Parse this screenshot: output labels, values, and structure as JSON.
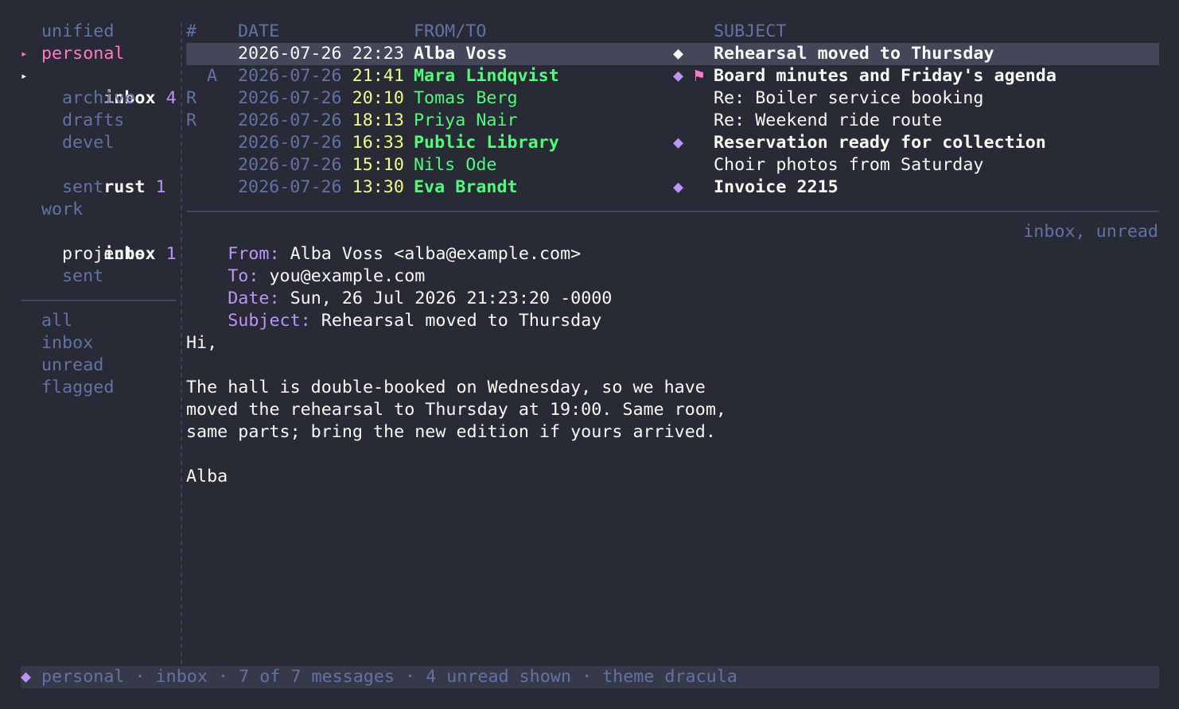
{
  "sidebar": {
    "accounts": [
      {
        "label": "unified"
      },
      {
        "label": "personal",
        "marker": "▸"
      },
      {
        "label": "inbox",
        "count": "4",
        "marker": "▸"
      },
      {
        "label": "archive"
      },
      {
        "label": "drafts"
      },
      {
        "label": "devel"
      },
      {
        "label": "rust",
        "count": "1"
      },
      {
        "label": "sent"
      },
      {
        "label": "work"
      },
      {
        "label": "inbox",
        "count": "1"
      },
      {
        "label": "projects"
      },
      {
        "label": "sent"
      }
    ],
    "views": [
      "all",
      "inbox",
      "unread",
      "flagged"
    ]
  },
  "list": {
    "headers": {
      "num": "#",
      "date": "DATE",
      "from": "FROM/TO",
      "subject": "SUBJECT"
    },
    "rows": [
      {
        "flag": "",
        "date": "2026-07-26",
        "time": "22:23",
        "from": "Alba Voss",
        "diamond": "◆",
        "star": "",
        "subject": "Rehearsal moved to Thursday",
        "unread": true,
        "selected": true
      },
      {
        "flag": "A",
        "date": "2026-07-26",
        "time": "21:41",
        "from": "Mara Lindqvist",
        "diamond": "◆",
        "star": "⚑",
        "subject": "Board minutes and Friday's agenda",
        "unread": true,
        "selected": false
      },
      {
        "flag": "R",
        "date": "2026-07-26",
        "time": "20:10",
        "from": "Tomas Berg",
        "diamond": "",
        "star": "",
        "subject": "Re: Boiler service booking",
        "unread": false,
        "selected": false
      },
      {
        "flag": "R",
        "date": "2026-07-26",
        "time": "18:13",
        "from": "Priya Nair",
        "diamond": "",
        "star": "",
        "subject": "Re: Weekend ride route",
        "unread": false,
        "selected": false
      },
      {
        "flag": "",
        "date": "2026-07-26",
        "time": "16:33",
        "from": "Public Library",
        "diamond": "◆",
        "star": "",
        "subject": "Reservation ready for collection",
        "unread": true,
        "selected": false
      },
      {
        "flag": "",
        "date": "2026-07-26",
        "time": "15:10",
        "from": "Nils Ode",
        "diamond": "",
        "star": "",
        "subject": "Choir photos from Saturday",
        "unread": false,
        "selected": false
      },
      {
        "flag": "",
        "date": "2026-07-26",
        "time": "13:30",
        "from": "Eva Brandt",
        "diamond": "◆",
        "star": "",
        "subject": "Invoice 2215",
        "unread": true,
        "selected": false
      }
    ]
  },
  "preview": {
    "from_label": "From:",
    "from_value": "Alba Voss <alba@example.com>",
    "to_label": "To:",
    "to_value": "you@example.com",
    "date_label": "Date:",
    "date_value": "Sun, 26 Jul 2026 21:23:20 -0000",
    "subject_label": "Subject:",
    "subject_value": "Rehearsal moved to Thursday",
    "tags": "inbox, unread",
    "body": [
      "Hi,",
      "",
      "The hall is double-booked on Wednesday, so we have",
      "moved the rehearsal to Thursday at 19:00. Same room,",
      "same parts; bring the new edition if yours arrived.",
      "",
      "Alba"
    ]
  },
  "status": {
    "icon": "◆",
    "text": "personal · inbox · 7 of 7 messages · 4 unread shown · theme dracula"
  },
  "colors": {
    "background": "#282a36",
    "selection": "#44475a",
    "comment": "#6272a4",
    "pink": "#ff79c6",
    "purple": "#bd93f9",
    "green": "#50fa7b",
    "yellow": "#f1fa8c",
    "foreground": "#f8f8f2"
  }
}
